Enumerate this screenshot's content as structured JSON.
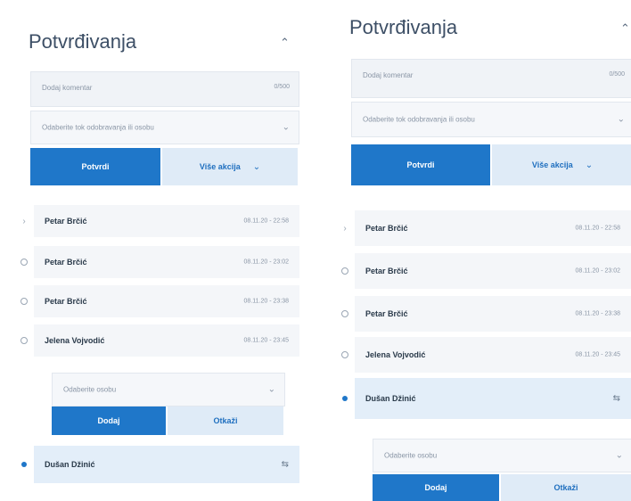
{
  "panels": [
    {
      "title": "Potvrđivanja",
      "comment": {
        "placeholder": "Dodaj komentar",
        "counter": "0/500"
      },
      "approver_select": {
        "placeholder": "Odaberite tok odobravanja ili osobu"
      },
      "confirm_label": "Potvrdi",
      "more_actions_label": "Više akcija",
      "approvals": [
        {
          "name": "Petar Brčić",
          "date": "08.11.20 - 22:58",
          "status": "expanded"
        },
        {
          "name": "Petar Brčić",
          "date": "08.11.20 - 23:02",
          "status": "pending"
        },
        {
          "name": "Petar Brčić",
          "date": "08.11.20 - 23:38",
          "status": "pending"
        },
        {
          "name": "Jelena Vojvodić",
          "date": "08.11.20 - 23:45",
          "status": "pending"
        }
      ],
      "assign": {
        "placeholder": "Odaberite osobu",
        "add_label": "Dodaj",
        "cancel_label": "Otkaži"
      },
      "current": {
        "name": "Dušan Džinić"
      }
    },
    {
      "title": "Potvrđivanja",
      "comment": {
        "placeholder": "Dodaj komentar",
        "counter": "0/500"
      },
      "approver_select": {
        "placeholder": "Odaberite tok odobravanja ili osobu"
      },
      "confirm_label": "Potvrdi",
      "more_actions_label": "Više akcija",
      "approvals": [
        {
          "name": "Petar Brčić",
          "date": "08.11.20 - 22:58",
          "status": "expanded"
        },
        {
          "name": "Petar Brčić",
          "date": "08.11.20 - 23:02",
          "status": "pending"
        },
        {
          "name": "Petar Brčić",
          "date": "08.11.20 - 23:38",
          "status": "pending"
        },
        {
          "name": "Jelena Vojvodić",
          "date": "08.11.20 - 23:45",
          "status": "pending"
        }
      ],
      "current": {
        "name": "Dušan Džinić"
      },
      "assign": {
        "placeholder": "Odaberite osobu",
        "add_label": "Dodaj",
        "cancel_label": "Otkaži"
      }
    }
  ],
  "colors": {
    "accent": "#1f77c9",
    "accent_light": "#dfebf7",
    "row_bg": "#f4f6f9",
    "active_row_bg": "#e3eef9"
  },
  "icons": {
    "collapse": "chevron-up-icon",
    "dropdown": "chevron-down-icon",
    "expanded_row": "chevron-right-icon",
    "pending": "circle-icon",
    "current": "dot-icon",
    "reassign": "reassign-icon"
  }
}
